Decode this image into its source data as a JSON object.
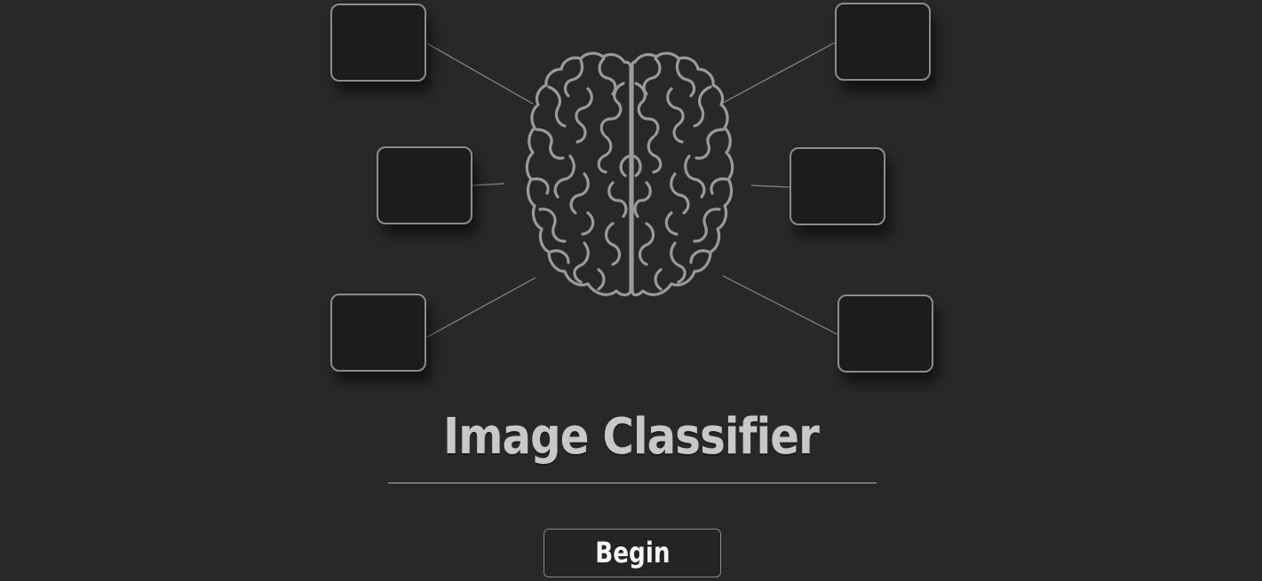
{
  "app": {
    "title": "Image Classifier"
  },
  "hero": {
    "icon": "brain-icon",
    "image_slots": [
      "image-slot",
      "image-slot",
      "image-slot",
      "image-slot",
      "image-slot",
      "image-slot"
    ]
  },
  "actions": {
    "begin_label": "Begin"
  },
  "colors": {
    "background": "#282828",
    "box_fill": "#1c1c1c",
    "box_border": "#8c8c8c",
    "brain_stroke": "#9a9a9a",
    "title_text": "#c8c8c8",
    "button_text": "#f4f4f4"
  }
}
